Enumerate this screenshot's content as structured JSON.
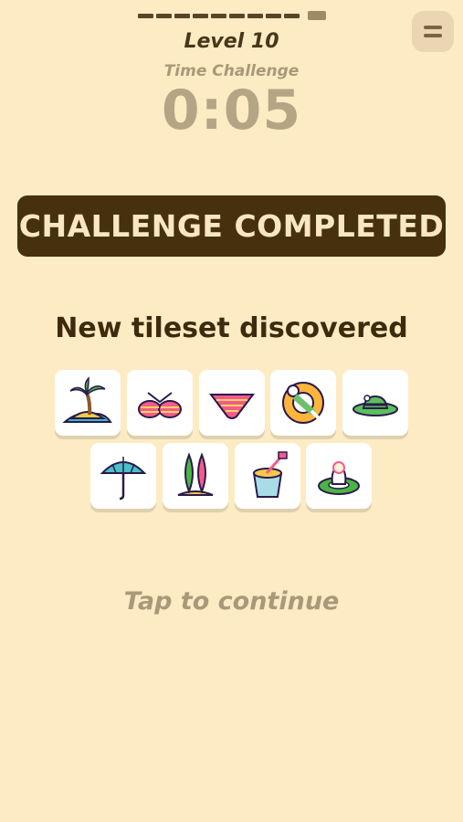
{
  "header": {
    "level_title": "Level 10",
    "mode_label": "Time Challenge",
    "timer": "0:05",
    "menu_icon": "hamburger-icon",
    "progress_segments_total": 10,
    "progress_segments_done": 9
  },
  "banner": {
    "text": "CHALLENGE COMPLETED"
  },
  "tileset": {
    "title": "New tileset discovered",
    "tiles": [
      {
        "icon": "palm-island-icon"
      },
      {
        "icon": "bikini-top-icon"
      },
      {
        "icon": "bikini-bottom-icon"
      },
      {
        "icon": "person-on-float-icon"
      },
      {
        "icon": "sun-hat-icon"
      },
      {
        "icon": "beach-umbrella-icon"
      },
      {
        "icon": "surfboards-icon"
      },
      {
        "icon": "sand-bucket-icon"
      },
      {
        "icon": "swim-ring-icon"
      }
    ]
  },
  "footer": {
    "continue_label": "Tap to continue"
  },
  "colors": {
    "background": "#fdebc3",
    "banner": "#47300e",
    "banner_text": "#f8e7c2",
    "title_text": "#3f2a0f",
    "muted_text": "#a8997a"
  }
}
